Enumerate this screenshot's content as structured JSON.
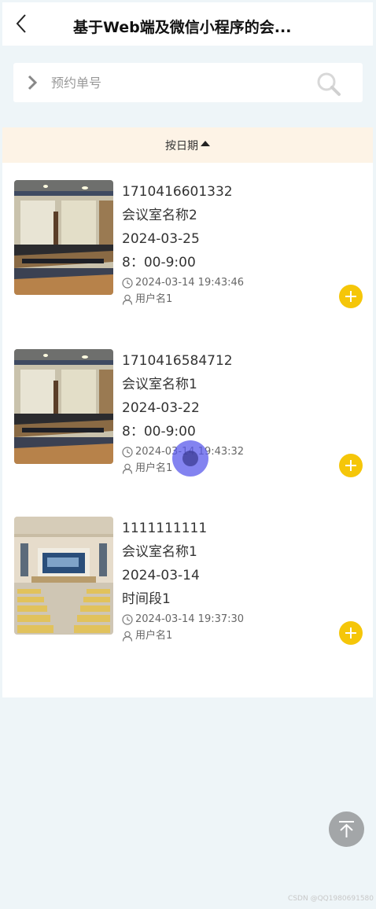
{
  "header": {
    "title": "基于Web端及微信小程序的会...",
    "back_icon": "chevron-left-icon"
  },
  "search": {
    "placeholder": "预约单号",
    "value": "",
    "prefix_icon": "chevron-right-icon",
    "search_icon": "search-icon"
  },
  "sort": {
    "label": "按日期",
    "direction_icon": "caret-up-icon"
  },
  "reservations": [
    {
      "order_no": "1710416601332",
      "room_name": "会议室名称2",
      "date": "2024-03-25",
      "time_slot": "8：00-9:00",
      "created_at": "2024-03-14 19:43:46",
      "user": "用户名1",
      "image": "meeting-room-photo"
    },
    {
      "order_no": "1710416584712",
      "room_name": "会议室名称1",
      "date": "2024-03-22",
      "time_slot": "8：00-9:00",
      "created_at": "2024-03-14 19:43:32",
      "user": "用户名1",
      "image": "meeting-room-photo"
    },
    {
      "order_no": "1111111111",
      "room_name": "会议室名称1",
      "date": "2024-03-14",
      "time_slot": "时间段1",
      "created_at": "2024-03-14 19:37:30",
      "user": "用户名1",
      "image": "auditorium-photo"
    }
  ],
  "icons": {
    "clock": "clock-icon",
    "user": "user-icon",
    "add": "plus-icon",
    "back_to_top": "arrow-up-to-top-icon"
  },
  "colors": {
    "accent": "#f5c609",
    "sort_bar_bg": "#fdf3e6",
    "page_bg": "#eef5f8"
  },
  "watermark": "CSDN @QQ1980691580"
}
